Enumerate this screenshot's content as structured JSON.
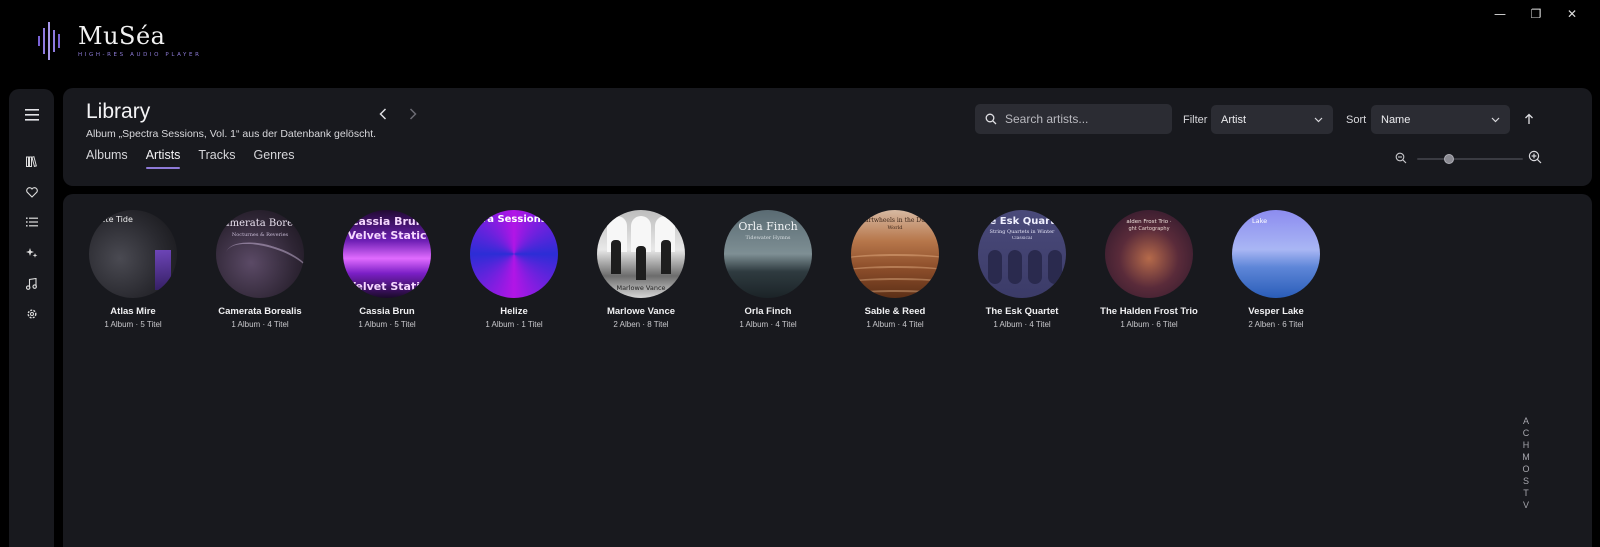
{
  "app": {
    "name": "MuSéa",
    "tagline": "HIGH-RES AUDIO PLAYER"
  },
  "window_controls": {
    "minimize": "—",
    "restore": "❐",
    "close": "✕"
  },
  "sidebar": {
    "items": [
      {
        "icon": "hamburger-menu-icon"
      },
      {
        "icon": "library-icon"
      },
      {
        "icon": "heart-icon"
      },
      {
        "icon": "list-icon"
      },
      {
        "icon": "sparkle-icon"
      },
      {
        "icon": "music-note-icon"
      },
      {
        "icon": "gear-icon"
      }
    ]
  },
  "header": {
    "title": "Library",
    "status_message": "Album „Spectra Sessions, Vol. 1“ aus der Datenbank gelöscht.",
    "tabs": [
      "Albums",
      "Artists",
      "Tracks",
      "Genres"
    ],
    "active_tab": "Artists",
    "search": {
      "placeholder": "Search artists...",
      "value": ""
    },
    "filter": {
      "label": "Filter",
      "value": "Artist"
    },
    "sort": {
      "label": "Sort",
      "value": "Name"
    },
    "zoom_level": 0.3
  },
  "artists": [
    {
      "name": "Atlas Mire",
      "meta": "1 Album · 5 Titel",
      "cover_text": "crete Tide"
    },
    {
      "name": "Camerata Borealis",
      "meta": "1 Album · 4 Titel",
      "cover_text": "Camerata Boreali",
      "cover_sub": "Nocturnes & Reveries"
    },
    {
      "name": "Cassia Brun",
      "meta": "1 Album · 5 Titel",
      "cover_text": "Cassia Brun",
      "cover_sub": "Velvet Static",
      "cover_bottom": "Velvet Static"
    },
    {
      "name": "Helize",
      "meta": "1 Album · 1 Titel",
      "cover_text": "tra Sessions,"
    },
    {
      "name": "Marlowe Vance",
      "meta": "2 Alben · 8 Titel",
      "cover_bottom": "Marlowe Vance"
    },
    {
      "name": "Orla Finch",
      "meta": "1 Album · 4 Titel",
      "cover_text": "Orla Finch",
      "cover_sub": "Tidewater Hymns"
    },
    {
      "name": "Sable & Reed",
      "meta": "1 Album · 4 Titel",
      "cover_text": "artwheels in the Du",
      "cover_sub": "World"
    },
    {
      "name": "The Esk Quartet",
      "meta": "1 Album · 4 Titel",
      "cover_text": "he Esk Quarte",
      "cover_sub": "String Quartets in Winter",
      "cover_sub2": "Classical"
    },
    {
      "name": "The Halden Frost Trio",
      "meta": "1 Album · 6 Titel",
      "cover_text": "alden Frost Trio ·",
      "cover_sub": "ght Cartography"
    },
    {
      "name": "Vesper Lake",
      "meta": "2 Alben · 6 Titel",
      "cover_text": "Lake"
    }
  ],
  "alphabet_index": [
    "A",
    "C",
    "H",
    "M",
    "O",
    "S",
    "T",
    "V"
  ]
}
